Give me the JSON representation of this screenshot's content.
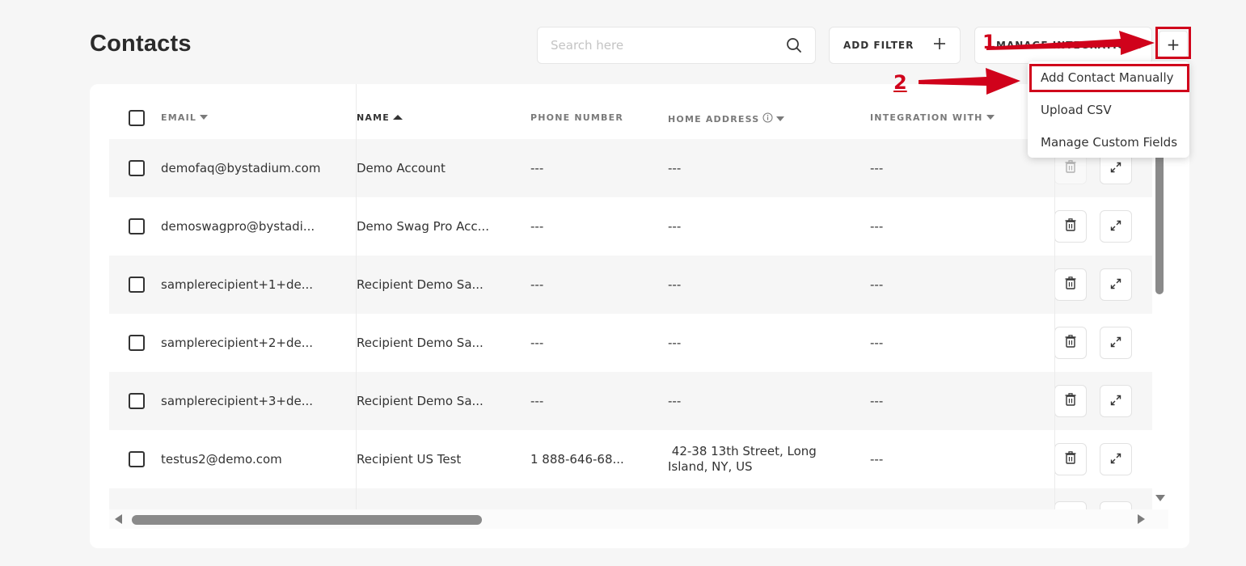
{
  "page": {
    "title": "Contacts"
  },
  "toolbar": {
    "search_placeholder": "Search here",
    "add_filter_label": "ADD FILTER",
    "manage_integrations_label": "MANAGE INTEGRATIONS",
    "plus_glyph": "+"
  },
  "table": {
    "columns": {
      "email": "EMAIL",
      "name": "NAME",
      "phone": "PHONE NUMBER",
      "address": "HOME ADDRESS",
      "integration": "INTEGRATION WITH"
    },
    "rows": [
      {
        "email": "demofaq@bystadium.com",
        "name": "Demo Account",
        "phone": "---",
        "address": "---",
        "integration": "---"
      },
      {
        "email": "demoswagpro@bystadi...",
        "name": "Demo Swag Pro Acc...",
        "phone": "---",
        "address": "---",
        "integration": "---"
      },
      {
        "email": "samplerecipient+1+de...",
        "name": "Recipient Demo Sa...",
        "phone": "---",
        "address": "---",
        "integration": "---"
      },
      {
        "email": "samplerecipient+2+de...",
        "name": "Recipient Demo Sa...",
        "phone": "---",
        "address": "---",
        "integration": "---"
      },
      {
        "email": "samplerecipient+3+de...",
        "name": "Recipient Demo Sa...",
        "phone": "---",
        "address": "---",
        "integration": "---"
      },
      {
        "email": "testus2@demo.com",
        "name": "Recipient US Test",
        "phone": "1 888-646-68...",
        "address": " 42-38 13th Street, Long Island, NY, US",
        "integration": "---"
      }
    ]
  },
  "dropdown": {
    "items": [
      "Add Contact Manually",
      "Upload CSV",
      "Manage Custom Fields"
    ]
  },
  "annotations": {
    "step1": "1",
    "step2": "2",
    "color": "#d0021b"
  }
}
